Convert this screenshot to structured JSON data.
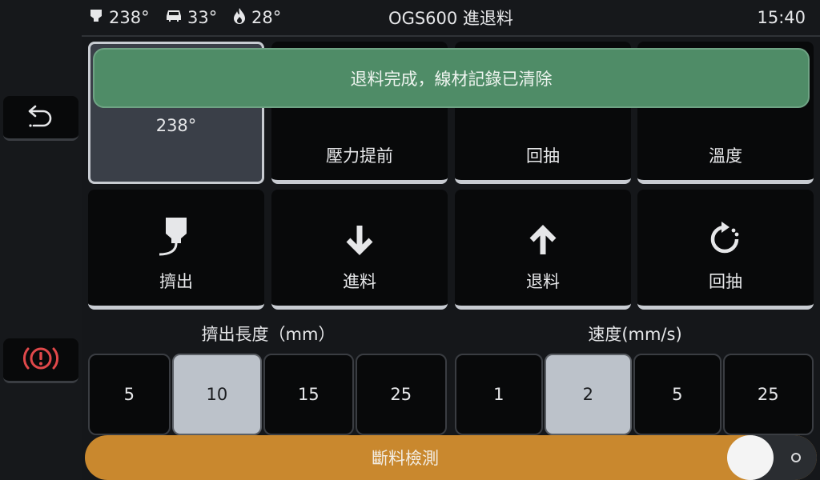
{
  "topbar": {
    "extruder_temp": "238°",
    "bed_temp": "33°",
    "chamber_temp": "28°",
    "title": "OGS600 進退料",
    "time": "15:40"
  },
  "toast": {
    "message": "退料完成，線材記錄已清除"
  },
  "tiles_row1": [
    {
      "label": "238°"
    },
    {
      "label": "壓力提前"
    },
    {
      "label": "回抽"
    },
    {
      "label": "溫度"
    }
  ],
  "tiles_row2": [
    {
      "label": "擠出",
      "icon": "extrude-icon"
    },
    {
      "label": "進料",
      "icon": "arrow-down-icon"
    },
    {
      "label": "退料",
      "icon": "arrow-up-icon"
    },
    {
      "label": "回抽",
      "icon": "retract-icon"
    }
  ],
  "length": {
    "title": "擠出長度（mm）",
    "options": [
      "5",
      "10",
      "15",
      "25"
    ],
    "selected": "10"
  },
  "speed": {
    "title": "速度(mm/s)",
    "options": [
      "1",
      "2",
      "5",
      "25"
    ],
    "selected": "2"
  },
  "sensor": {
    "label": "斷料檢測",
    "enabled": true
  },
  "colors": {
    "toast": "#4f8c67",
    "sensor_on": "#c9882e",
    "estop": "#e0484a",
    "selected": "#bcc2ca"
  }
}
